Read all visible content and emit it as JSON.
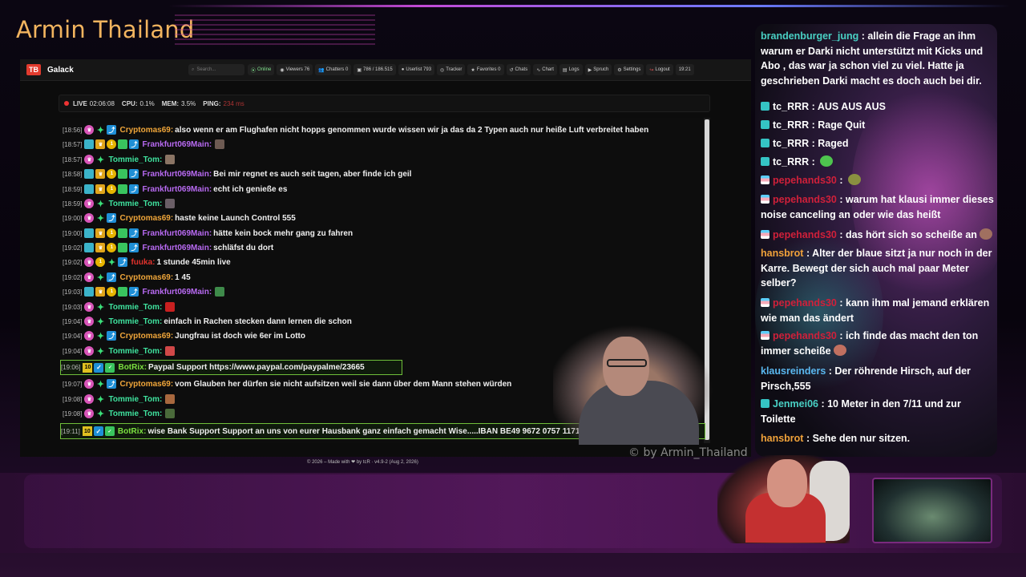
{
  "stream": {
    "title": "Armin Thailand",
    "watermark": "© by Armin_Thailand"
  },
  "app": {
    "name": "Galack",
    "logo": "TB",
    "search_placeholder": "Search...",
    "nav": [
      {
        "label": "Online",
        "icon": "wifi-icon"
      },
      {
        "label": "Viewers  76",
        "icon": "eye-icon"
      },
      {
        "label": "Chatters  0",
        "icon": "users-icon"
      },
      {
        "label": "786 / 186.515",
        "icon": "chat-icon"
      },
      {
        "label": "Userlist  793",
        "icon": "user-icon"
      },
      {
        "label": "Tracker",
        "icon": "target-icon"
      },
      {
        "label": "Favorites  0",
        "icon": "star-icon"
      },
      {
        "label": "Chats",
        "icon": "history-icon"
      },
      {
        "label": "Chart",
        "icon": "chart-icon"
      },
      {
        "label": "Logs",
        "icon": "log-icon"
      },
      {
        "label": "Spruch",
        "icon": "quote-icon"
      },
      {
        "label": "Settings",
        "icon": "gear-icon"
      },
      {
        "label": "Logout",
        "icon": "logout-icon"
      },
      {
        "label": "19:21",
        "icon": ""
      }
    ],
    "status": {
      "live": "LIVE",
      "live_time": "02:06:08",
      "cpu_label": "CPU:",
      "cpu": "0.1%",
      "mem_label": "MEM:",
      "mem": "3.5%",
      "ping_label": "PING:",
      "ping": "234 ms"
    },
    "footer": "© 2026 – Made with ❤ by tcR · v4.9-2 (Aug 2, 2026)"
  },
  "colors": {
    "cryptomas": "#f0a63a",
    "frankfurt": "#b86af2",
    "tommie": "#3fe29e",
    "fuuka": "#e0322c",
    "botrix": "#7be040",
    "accent_red": "#e23b2e"
  },
  "chat": [
    {
      "time": "[18:56]",
      "user": "Cryptomas69",
      "color": "cryptomas",
      "kind": "c",
      "text": "also wenn er am Flughafen nicht hopps genommen wurde wissen wir ja das da 2 Typen auch nur heiße Luft verbreitet haben"
    },
    {
      "time": "[18:57]",
      "user": "Frankfurt069Main",
      "color": "frankfurt",
      "kind": "f",
      "text": "",
      "emote": "#6d5a52"
    },
    {
      "time": "[18:57]",
      "user": "Tommie_Tom",
      "color": "tommie",
      "kind": "t",
      "text": "",
      "emote": "#8a7464"
    },
    {
      "time": "[18:58]",
      "user": "Frankfurt069Main",
      "color": "frankfurt",
      "kind": "f",
      "text": "Bei mir regnet es auch seit tagen, aber finde ich geil"
    },
    {
      "time": "[18:59]",
      "user": "Frankfurt069Main",
      "color": "frankfurt",
      "kind": "f",
      "text": "echt ich genieße es"
    },
    {
      "time": "[18:59]",
      "user": "Tommie_Tom",
      "color": "tommie",
      "kind": "t",
      "text": "",
      "emote": "#6a5e66"
    },
    {
      "time": "[19:00]",
      "user": "Cryptomas69",
      "color": "cryptomas",
      "kind": "c",
      "text": "haste keine Launch Control 555"
    },
    {
      "time": "[19:00]",
      "user": "Frankfurt069Main",
      "color": "frankfurt",
      "kind": "f",
      "text": "hätte kein bock mehr gang zu fahren"
    },
    {
      "time": "[19:02]",
      "user": "Frankfurt069Main",
      "color": "frankfurt",
      "kind": "f",
      "text": "schläfst du dort"
    },
    {
      "time": "[19:02]",
      "user": "fuuka",
      "color": "fuuka",
      "kind": "x",
      "text": "1 stunde 45min live"
    },
    {
      "time": "[19:02]",
      "user": "Cryptomas69",
      "color": "cryptomas",
      "kind": "c",
      "text": "1 45"
    },
    {
      "time": "[19:03]",
      "user": "Frankfurt069Main",
      "color": "frankfurt",
      "kind": "f",
      "text": "",
      "emote": "#3e8a4a"
    },
    {
      "time": "[19:03]",
      "user": "Tommie_Tom",
      "color": "tommie",
      "kind": "t",
      "text": "",
      "emote": "#c82020"
    },
    {
      "time": "[19:04]",
      "user": "Tommie_Tom",
      "color": "tommie",
      "kind": "t",
      "text": "einfach in Rachen stecken dann lernen die schon"
    },
    {
      "time": "[19:04]",
      "user": "Cryptomas69",
      "color": "cryptomas",
      "kind": "c",
      "text": "Jungfrau ist doch wie 6er im Lotto"
    },
    {
      "time": "[19:04]",
      "user": "Tommie_Tom",
      "color": "tommie",
      "kind": "t",
      "text": "",
      "emote": "#d04848"
    },
    {
      "time": "[19:06]",
      "user": "BotRix",
      "color": "botrix",
      "kind": "b",
      "text": "Paypal Support https://www.paypal.com/paypalme/23665"
    },
    {
      "time": "[19:07]",
      "user": "Cryptomas69",
      "color": "cryptomas",
      "kind": "c",
      "text": "vom Glauben her dürfen sie nicht aufsitzen weil sie dann über dem Mann stehen würden"
    },
    {
      "time": "[19:08]",
      "user": "Tommie_Tom",
      "color": "tommie",
      "kind": "t",
      "text": "",
      "emote": "#a8683e"
    },
    {
      "time": "[19:08]",
      "user": "Tommie_Tom",
      "color": "tommie",
      "kind": "t",
      "text": "",
      "emote": "#4a6a3a"
    },
    {
      "time": "[19:11]",
      "user": "BotRix",
      "color": "botrix",
      "kind": "b",
      "text": "wise Bank Support Support an uns von eurer Hausbank ganz einfach gemacht Wise.....IBAN BE49 9672 0757 1171"
    }
  ],
  "twitch_chat": [
    {
      "user": "brandenburger_jung",
      "color": "#49d0c4",
      "icon": "",
      "text": "allein die Frage an ihm warum er Darki nicht unterstützt mit Kicks und Abo , das war ja schon viel zu viel. Hatte ja geschrieben Darki macht es doch auch bei dir."
    },
    {
      "user": "tc_RRR",
      "color": "#ffffff",
      "icon": "teal",
      "text": "AUS AUS AUS"
    },
    {
      "user": "tc_RRR",
      "color": "#ffffff",
      "icon": "teal",
      "text": "Rage Quit"
    },
    {
      "user": "tc_RRR",
      "color": "#ffffff",
      "icon": "teal",
      "text": "Raged"
    },
    {
      "user": "tc_RRR",
      "color": "#ffffff",
      "icon": "teal",
      "text": "",
      "emote": "#4ec44e"
    },
    {
      "user": "pepehands30",
      "color": "#d0203a",
      "icon": "flag",
      "text": "",
      "emote": "#8a9040"
    },
    {
      "user": "pepehands30",
      "color": "#d0203a",
      "icon": "flag",
      "text": "warum hat klausi immer dieses noise canceling an oder wie das heißt"
    },
    {
      "user": "pepehands30",
      "color": "#d0203a",
      "icon": "flag",
      "text": "das hört sich so scheiße an",
      "emote": "#a07060"
    },
    {
      "user": "hansbrot",
      "color": "#f0a23a",
      "icon": "",
      "text": "Alter der blaue sitzt ja nur noch in der Karre. Bewegt der sich auch mal paar Meter selber?"
    },
    {
      "user": "pepehands30",
      "color": "#d0203a",
      "icon": "flag",
      "text": "kann ihm mal jemand erklären wie man das ändert"
    },
    {
      "user": "pepehands30",
      "color": "#d0203a",
      "icon": "flag",
      "text": "ich finde das macht den ton immer scheiße",
      "emote": "#c07060"
    },
    {
      "user": "klausreinders",
      "color": "#5ab8f0",
      "icon": "",
      "text": "Der röhrende Hirsch, auf der Pirsch,555"
    },
    {
      "user": "Jenmei06",
      "color": "#49d0c4",
      "icon": "teal",
      "text": "10 Meter in den 7/11 und zur Toilette"
    },
    {
      "user": "hansbrot",
      "color": "#f0a23a",
      "icon": "",
      "text": "Sehe den nur sitzen."
    }
  ]
}
